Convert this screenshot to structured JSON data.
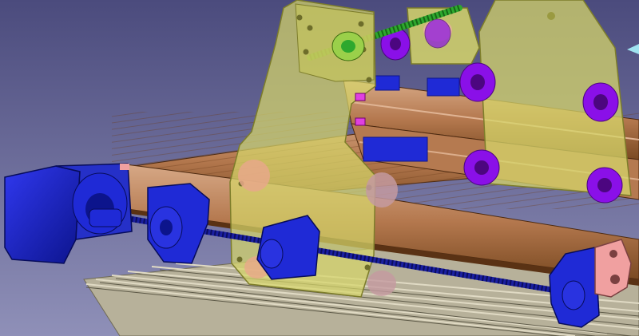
{
  "app": {
    "kind": "CAD 3D assembly viewport"
  },
  "scene": {
    "background_top": "#4b4b7d",
    "background_bottom": "#8f90b8",
    "colors": {
      "motor": "#1f2ad6",
      "motor_dark": "#0c148c",
      "aluminum_profile": "#c99a78",
      "profile_shadow": "#7a4a22",
      "translucent_plate": "#d6d66a",
      "plate_edge": "#7d7d2a",
      "wheel": "#8a10e8",
      "wheel_dark": "#4c0680",
      "lead_screw": "#1a1fa0",
      "green_screw": "#2ea82e",
      "pink_bracket": "#f0a0a0",
      "magenta_mark": "#e040e0",
      "slat": "#c8c2aa"
    },
    "icons": [
      "stepper-motor-icon",
      "lead-screw-icon",
      "gantry-plate-icon",
      "v-wheel-icon",
      "aluminum-extrusion-icon",
      "bearing-block-icon"
    ]
  }
}
